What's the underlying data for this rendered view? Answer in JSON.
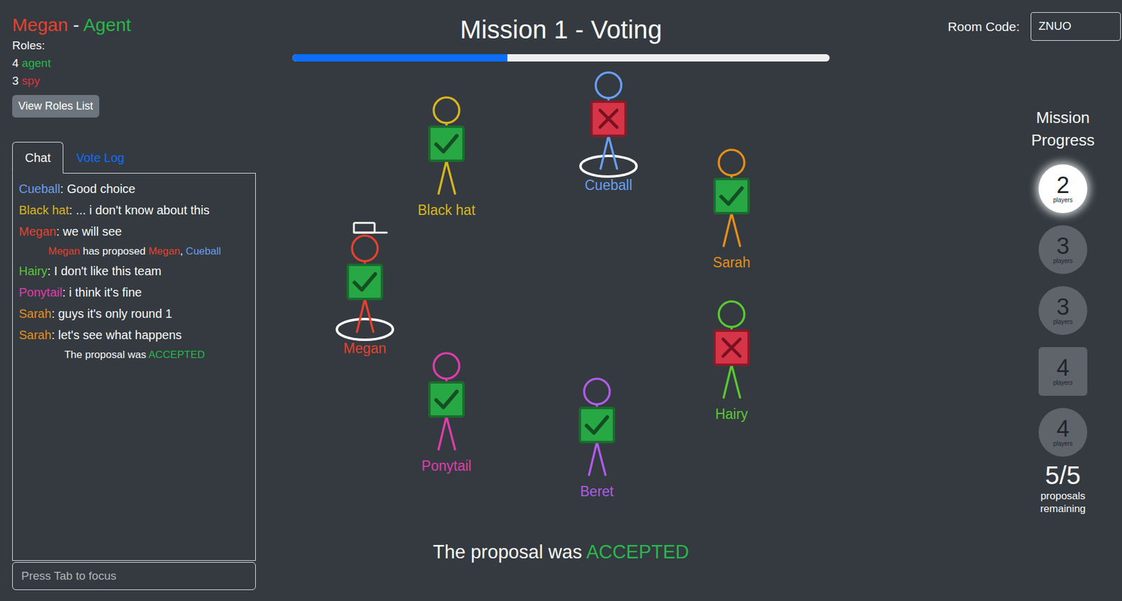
{
  "player": {
    "name": "Megan",
    "name_color": "#e5412e",
    "separator": " - ",
    "role": "Agent",
    "role_color": "#28b84a"
  },
  "roles": {
    "heading": "Roles:",
    "items": [
      {
        "count": "4",
        "label": "agent",
        "color": "#28b84a"
      },
      {
        "count": "3",
        "label": "spy",
        "color": "#e0323e"
      }
    ]
  },
  "roles_button": "View Roles List",
  "tabs": [
    {
      "label": "Chat",
      "selected": true
    },
    {
      "label": "Vote Log",
      "selected": false
    }
  ],
  "chat": [
    {
      "kind": "message",
      "parts": [
        {
          "text": "Cueball",
          "color": "#6a9ef0"
        },
        {
          "text": ": Good choice"
        }
      ]
    },
    {
      "kind": "message",
      "parts": [
        {
          "text": "Black hat",
          "color": "#d8b51e"
        },
        {
          "text": ": ... i don't know about this"
        }
      ]
    },
    {
      "kind": "message",
      "parts": [
        {
          "text": "Megan",
          "color": "#e5412e"
        },
        {
          "text": ": we will see"
        }
      ]
    },
    {
      "kind": "event",
      "parts": [
        {
          "text": "Megan",
          "color": "#e5412e"
        },
        {
          "text": " has proposed "
        },
        {
          "text": "Megan",
          "color": "#e5412e"
        },
        {
          "text": ", "
        },
        {
          "text": "Cueball",
          "color": "#6a9ef0"
        }
      ]
    },
    {
      "kind": "message",
      "parts": [
        {
          "text": "Hairy",
          "color": "#5ac832"
        },
        {
          "text": ": I don't like this team"
        }
      ]
    },
    {
      "kind": "message",
      "parts": [
        {
          "text": "Ponytail",
          "color": "#e03caa"
        },
        {
          "text": ": i think it's fine"
        }
      ]
    },
    {
      "kind": "message",
      "parts": [
        {
          "text": "Sarah",
          "color": "#e58e1a"
        },
        {
          "text": ": guys it's only round 1"
        }
      ]
    },
    {
      "kind": "message",
      "parts": [
        {
          "text": "Sarah",
          "color": "#e58e1a"
        },
        {
          "text": ": let's see what happens"
        }
      ]
    },
    {
      "kind": "event",
      "parts": [
        {
          "text": "The proposal was "
        },
        {
          "text": "ACCEPTED",
          "color": "#28b84a"
        }
      ]
    }
  ],
  "chat_input": {
    "placeholder": "Press Tab to focus"
  },
  "title": "Mission 1 - Voting",
  "timer": {
    "level": 0.4
  },
  "players": [
    {
      "name": "Megan",
      "color": "#e5412e",
      "vote": "approve",
      "on_team": true,
      "leader": true
    },
    {
      "name": "Black hat",
      "color": "#d8b51e",
      "vote": "approve",
      "on_team": false,
      "leader": false
    },
    {
      "name": "Cueball",
      "color": "#6a9ef0",
      "vote": "reject",
      "on_team": true,
      "leader": false
    },
    {
      "name": "Sarah",
      "color": "#e58e1a",
      "vote": "approve",
      "on_team": false,
      "leader": false
    },
    {
      "name": "Hairy",
      "color": "#5ac832",
      "vote": "reject",
      "on_team": false,
      "leader": false
    },
    {
      "name": "Beret",
      "color": "#b05ce8",
      "vote": "approve",
      "on_team": false,
      "leader": false
    },
    {
      "name": "Ponytail",
      "color": "#e03caa",
      "vote": "approve",
      "on_team": false,
      "leader": false
    }
  ],
  "result": {
    "text": "The proposal was ",
    "status": "ACCEPTED",
    "status_color": "#28b84a"
  },
  "room": {
    "label": "Room Code:",
    "code": "ZNUO"
  },
  "mission_progress": {
    "title": "Mission Progress",
    "missions": [
      {
        "count": "2",
        "label": "players",
        "current": true,
        "two_fails_required": false
      },
      {
        "count": "3",
        "label": "players",
        "current": false,
        "two_fails_required": false
      },
      {
        "count": "3",
        "label": "players",
        "current": false,
        "two_fails_required": false
      },
      {
        "count": "4",
        "label": "players",
        "current": false,
        "two_fails_required": true
      },
      {
        "count": "4",
        "label": "players",
        "current": false,
        "two_fails_required": false
      }
    ],
    "proposals": {
      "value": "5/5",
      "label": "proposals remaining"
    }
  }
}
